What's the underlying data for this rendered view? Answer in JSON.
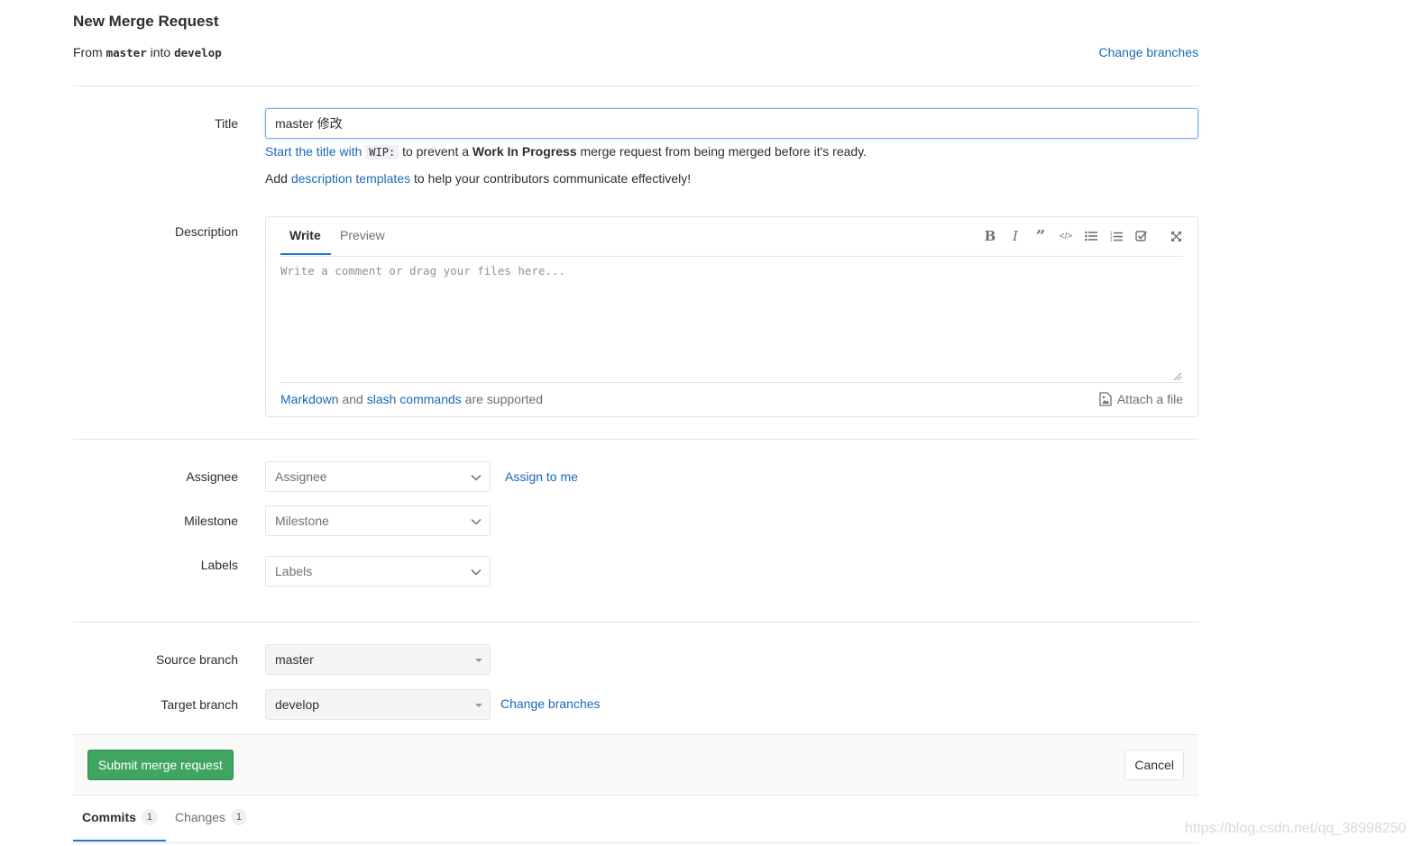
{
  "header": {
    "title": "New Merge Request",
    "from_prefix": "From",
    "source": "master",
    "into": "into",
    "target": "develop",
    "change_branches": "Change branches"
  },
  "form": {
    "title_label": "Title",
    "title_value": "master 修改",
    "wip_hint_link": "Start the title with",
    "wip_code": "WIP:",
    "wip_hint_rest1": "to prevent a",
    "wip_hint_bold": "Work In Progress",
    "wip_hint_rest2": "merge request from being merged before it's ready.",
    "templates_prefix": "Add",
    "templates_link": "description templates",
    "templates_rest": "to help your contributors communicate effectively!",
    "description_label": "Description",
    "tab_write": "Write",
    "tab_preview": "Preview",
    "description_placeholder": "Write a comment or drag your files here...",
    "markdown_link": "Markdown",
    "and": "and",
    "slash_link": "slash commands",
    "supported": "are supported",
    "attach": "Attach a file",
    "toolbar_icons": [
      "bold-icon",
      "italic-icon",
      "quote-icon",
      "code-icon",
      "bullet-list-icon",
      "numbered-list-icon",
      "task-list-icon",
      "fullscreen-icon"
    ],
    "assignee_label": "Assignee",
    "assignee_placeholder": "Assignee",
    "assign_to_me": "Assign to me",
    "milestone_label": "Milestone",
    "milestone_placeholder": "Milestone",
    "labels_label": "Labels",
    "labels_placeholder": "Labels",
    "source_label": "Source branch",
    "source_value": "master",
    "target_label": "Target branch",
    "target_value": "develop",
    "change_branches": "Change branches"
  },
  "actions": {
    "submit": "Submit merge request",
    "cancel": "Cancel"
  },
  "tabs": [
    {
      "label": "Commits",
      "count": "1"
    },
    {
      "label": "Changes",
      "count": "1"
    }
  ],
  "watermark": "https://blog.csdn.net/qq_38998250",
  "colors": {
    "link": "#1b69b6",
    "submit_bg": "#3fa560",
    "focus_border": "#73afea",
    "tab_underline": "#1f78d1"
  }
}
